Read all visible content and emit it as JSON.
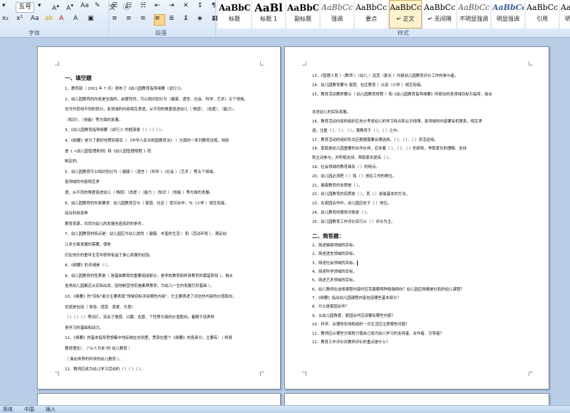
{
  "ribbon": {
    "font_size": "五号",
    "font_group_label": "字体",
    "paragraph_group_label": "段落",
    "styles_group_label": "样式",
    "styles": [
      {
        "preview": "AaBbC",
        "name": "标题"
      },
      {
        "preview": "AaBl",
        "name": "标题 1"
      },
      {
        "preview": "AaBbC",
        "name": "副标题"
      },
      {
        "preview": "AaBbCcD",
        "name": "强调"
      },
      {
        "preview": "AaBbCcD",
        "name": "要点"
      },
      {
        "preview": "AaBbCcD",
        "name": "↵ 正文"
      },
      {
        "preview": "AaBbCcD",
        "name": "↵ 无间隔"
      },
      {
        "preview": "AaBbCcD",
        "name": "不明显强调"
      },
      {
        "preview": "AaBbCcD",
        "name": "明显强调"
      },
      {
        "preview": "AaBbCcD",
        "name": "引用"
      },
      {
        "preview": "AaBbCcD",
        "name": "明显引用"
      }
    ]
  },
  "page1": {
    "heading": "一、填空题",
    "lines": [
      "1、教育部（    2001 年 7 月）颁布了《幼儿园教育指导纲要（试行）》。",
      "2、幼儿园教育的内容是全面的，启蒙性的，可以相对划分为（健康、语言、社会、科学、艺术）五个领域，",
      "       也可作其他不同的划分。各领域的内容相互渗透，从不同的角度促进幼儿（  情感）、（态度）、（能力）。",
      "       （知识）、（技能）等方面的发展。",
      "3、《幼儿园教育指导纲要（试行）》的框架是（      ）（      ）（      ）。",
      "4、《纲要》是为了更好地贯彻落实（    《中华人民共和国教育法》    ）方面的一系列教育法规，特别",
      "       是《  <幼儿园管理条例》和《幼儿园管理规程  》而",
      "       制定的。",
      "5、幼儿园教育可以相对划分为（  健康  ）（语言    ）（科学    ）（社会    ）（艺术    ）等五个领域。",
      "       各领域的内容相互渗",
      "       透，从不同的角度促进幼儿（   情感）（态度    ）（能力    ）（知识    ）（技能    ）等方面的发展。",
      "6、幼儿园教育的外部要求：幼儿园教育应与（   家庭、社区  ）密切合作，与（小学     ）相互衔接，",
      "       综合利用各种",
      "       教育资源，共同为幼儿的发展创造良好的条件。",
      "7、幼儿园教育的特点是：幼儿园应为幼儿提供（   健康、丰富的生活    ）和（活动环境     ），满足幼",
      "       儿多方面发展的需要，使他",
      "       们在快乐的童年生活中获得有益于身心发展的经验。",
      "8、《纲要》的灵魂是（      ）。",
      "9、幼儿园教育的性质是（    是基础教育的重要组成部分，是学校教育和终身教育的奠基阶段  ）。城乡",
      "       各类幼儿园都应从实际出发，因地制宜地实施素质教育，为幼儿一生的发展打好基础  ）。",
      "10、《纲要》的\"目标\"部分主要表现\"领域目标涉及哪些内容\"，它主要表述了对这些内容的价值取向，",
      "       也就是包括（    体验、感受、喜爱、乐意）",
      "       （    ）（    ）（    ）等词汇，突出了情感、兴趣、态度、个性等方面的价值取向，着眼于培养终",
      "       身学习的基础和动力。",
      "11、《纲要》的基本指导思想集中地反映在总则里，贯穿在整个《纲要》的各部分，主要有：（    终身",
      "       教育理念）、（\"以人为本\"的  幼儿教育   ）",
      "       （  面向世界的科学的幼儿教育  ）。",
      "12、教师应成为幼儿学习活动的（      ）（      ）（      ）。"
    ]
  },
  "page2": {
    "lines_top": [
      "13、《管理人员     ）（教师     ）（幼儿    ）及其（家长     ）均是幼儿园教育评价工作的参与者。",
      "14、幼儿园教育要与   家庭、社区教育  ）以及（小学     ）相互衔接。",
      "15、教育活动教师要以（    幼儿园教育规程  ）和《幼儿园教育指导纲要》所提出的各领域目标为指导，结合",
      "",
      "       本班幼儿的实际发展。",
      "16、教育活动内容的组织应充分考虑幼儿的学习特点和认识规律，各领域的内容要有机联系，相互渗",
      "       透，注重（      ）、（      ）、（      ），寓教育于（      ）、（      ）之中。",
      "17、教育活动的组织形式应根据需要合理选择，（      ）、（      ）、（      ）灵活运用。",
      "18、家庭是幼儿园重要的合作伙伴，应本着（      ）、（      ）、（      ）的原则，争取家长的理解、支持",
      "       和主动参与，并积极支持、帮助家长提高（      ）。",
      "19、社会领域的教育具有（       ）的特点。",
      "20、幼儿园必须把（      ）和（      ）放在工作的首位。",
      "21、健康教育的本质是（      ）。",
      "22、幼儿园教育的实质是（      ），其（      ）是最基本的方法。",
      "23、在家园合作中，幼儿园应处于（      ）地位。",
      "24、幼儿教育的服务对象是（      ）。",
      "25、幼儿园教育工作评价实行以（      ）评价为主。"
    ],
    "heading": "二、简答题：",
    "lines_bottom": [
      "1、简述健康领域的目标。",
      "2、简述语言领域的目标。",
      "3、简述社会领域的目标。",
      "4、简述科学领域的目标。",
      "5、简述艺术领域的目标。",
      "6、幼儿教师在选择课程内容时应克服哪两种极端倾向？幼儿园应得都是社和的幼儿课程？",
      "7、《纲要》指出幼儿园课程内容包括哪些基本部分？",
      "8、什么是家园合作？",
      "9、从幼儿园角度，家园合作应该要有哪些内容？",
      "10、科学、合理地安排和组织一日生活应注意哪些问题？",
      "11、教师应从哪些方面努力使自己成为幼儿学习的支持者、合作者、引导者？",
      "12、教育工作评价对教师评价的重点是什么？"
    ]
  },
  "status": {
    "left": "简体",
    "language": "中国",
    "mode": "插入"
  }
}
